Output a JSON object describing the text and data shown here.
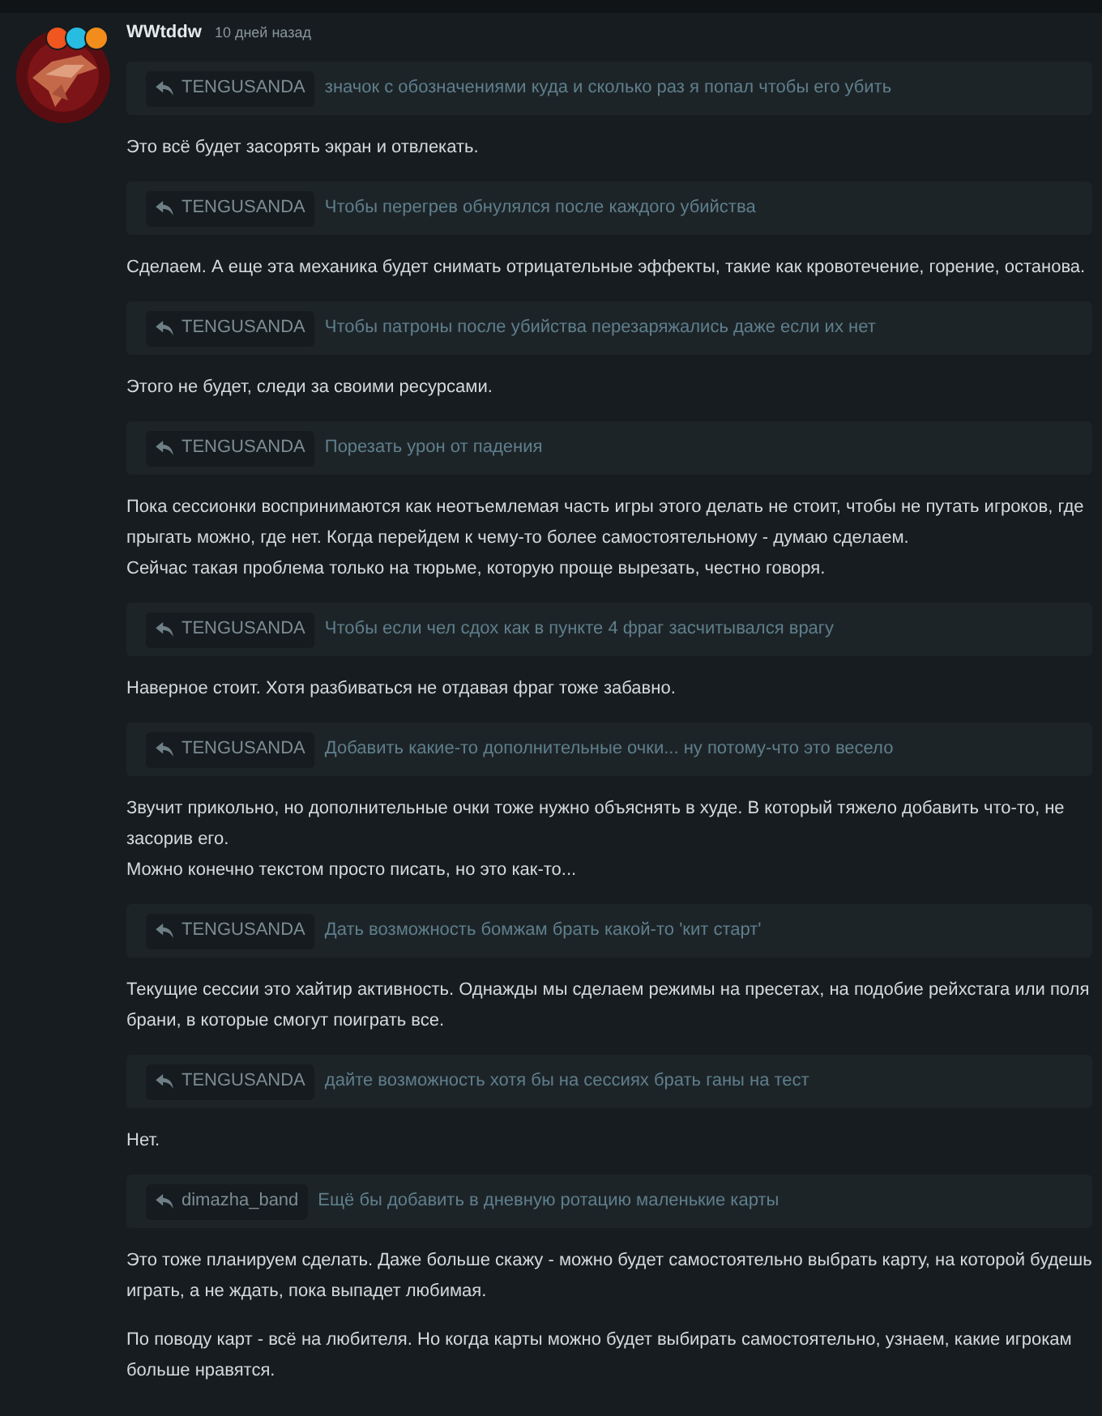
{
  "comment": {
    "author": "WWtddw",
    "time": "10 дней назад",
    "badges": [
      {
        "color": "#f0561e"
      },
      {
        "color": "#27bde0"
      },
      {
        "color": "#f28c1a"
      }
    ],
    "items": [
      {
        "kind": "quote",
        "user": "TENGUSANDA",
        "text": "значок с обозначениями куда и сколько раз я попал чтобы его убить"
      },
      {
        "kind": "text",
        "lines": [
          "Это всё будет засорять экран и отвлекать."
        ]
      },
      {
        "kind": "quote",
        "user": "TENGUSANDA",
        "text": "Чтобы перегрев обнулялся после каждого убийства"
      },
      {
        "kind": "text",
        "lines": [
          "Сделаем. А еще эта механика будет снимать отрицательные эффекты, такие как кровотечение, горение, останова."
        ]
      },
      {
        "kind": "quote",
        "user": "TENGUSANDA",
        "text": "Чтобы патроны после убийства перезаряжались даже если их нет"
      },
      {
        "kind": "text",
        "lines": [
          "Этого не будет, следи за своими ресурсами."
        ]
      },
      {
        "kind": "quote",
        "user": "TENGUSANDA",
        "text": "Порезать урон от падения"
      },
      {
        "kind": "text",
        "lines": [
          "Пока сессионки воспринимаются как неотъемлемая часть игры этого делать не стоит, чтобы не путать игроков, где прыгать можно, где нет. Когда перейдем к чему-то более самостоятельному - думаю сделаем.",
          "Сейчас такая проблема только на тюрьме, которую проще вырезать, честно говоря."
        ]
      },
      {
        "kind": "quote",
        "user": "TENGUSANDA",
        "text": "Чтобы если чел сдох как в пункте 4 фраг засчитывался врагу"
      },
      {
        "kind": "text",
        "lines": [
          "Наверное стоит. Хотя разбиваться не отдавая фраг тоже забавно."
        ]
      },
      {
        "kind": "quote",
        "user": "TENGUSANDA",
        "text": "Добавить какие-то дополнительные очки... ну потому-что это весело"
      },
      {
        "kind": "text",
        "lines": [
          "Звучит прикольно, но дополнительные очки тоже нужно объяснять в худе. В который тяжело добавить что-то, не засорив его.",
          "Можно конечно текстом просто писать, но это как-то..."
        ]
      },
      {
        "kind": "quote",
        "user": "TENGUSANDA",
        "text": "Дать возможность бомжам брать какой-то 'кит старт'"
      },
      {
        "kind": "text",
        "lines": [
          "Текущие сессии это хайтир активность. Однажды мы сделаем режимы на пресетах, на подобие рейхстага или поля брани, в которые смогут поиграть все."
        ]
      },
      {
        "kind": "quote",
        "user": "TENGUSANDA",
        "text": "дайте возможность хотя бы на сессиях брать ганы на тест"
      },
      {
        "kind": "text",
        "lines": [
          "Нет."
        ]
      },
      {
        "kind": "quote",
        "user": "dimazha_band",
        "text": "Ещё бы добавить в дневную ротацию маленькие карты"
      },
      {
        "kind": "text",
        "lines": [
          "Это тоже планируем сделать. Даже больше скажу - можно будет самостоятельно выбрать карту, на которой будешь играть, а не ждать, пока выпадет любимая."
        ]
      },
      {
        "kind": "text",
        "lines": [
          "По поводу карт - всё на любителя. Но когда карты можно будет выбирать самостоятельно, узнаем, какие игрокам больше нравятся."
        ]
      }
    ]
  }
}
